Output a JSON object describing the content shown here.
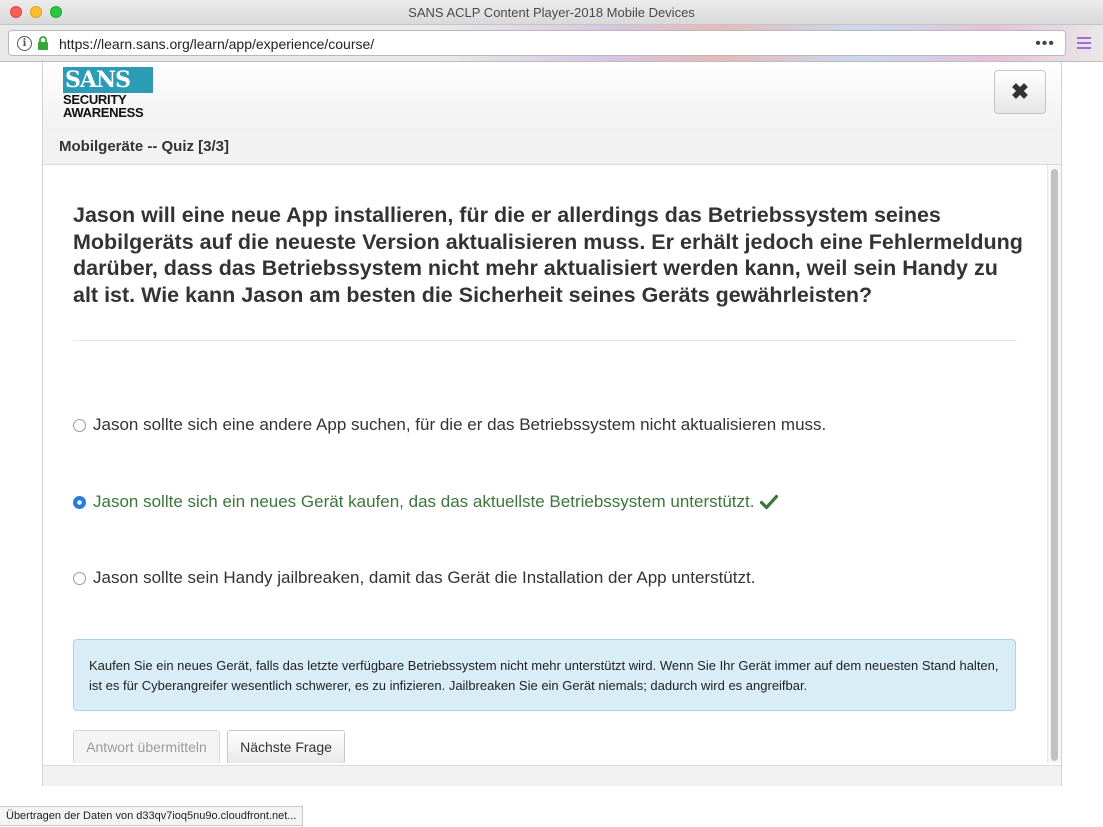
{
  "window": {
    "title": "SANS ACLP Content Player-2018 Mobile Devices"
  },
  "browser": {
    "url": "https://learn.sans.org/learn/app/experience/course/",
    "more_label": "•••",
    "status_text": "Übertragen der Daten von d33qv7ioq5nu9o.cloudfront.net..."
  },
  "logo": {
    "brand": "SANS",
    "line1": "SECURITY",
    "line2": "AWARENESS"
  },
  "header": {
    "close_label": "✖"
  },
  "breadcrumb": {
    "title": "Mobilgeräte -- Quiz [3/3]"
  },
  "quiz": {
    "question": "Jason will eine neue App installieren, für die er allerdings das Betriebssystem seines Mobilgeräts auf die neueste Version aktualisieren muss. Er erhält jedoch eine Fehlermeldung darüber, dass das Betriebssystem nicht mehr aktualisiert werden kann, weil sein Handy zu alt ist. Wie kann Jason am besten die Sicherheit seines Geräts gewährleisten?",
    "options": [
      {
        "label": "Jason sollte sich eine andere App suchen, für die er das Betriebssystem nicht aktualisieren muss.",
        "selected": false,
        "correct": false
      },
      {
        "label": "Jason sollte sich ein neues Gerät kaufen, das das aktuellste Betriebssystem unterstützt.",
        "selected": true,
        "correct": true
      },
      {
        "label": "Jason sollte sein Handy jailbreaken, damit das Gerät die Installation der App unterstützt.",
        "selected": false,
        "correct": false
      }
    ],
    "feedback": "Kaufen Sie ein neues Gerät, falls das letzte verfügbare Betriebssystem nicht mehr unterstützt wird. Wenn Sie Ihr Gerät immer auf dem neuesten Stand halten, ist es für Cyberangreifer wesentlich schwerer, es zu infizieren. Jailbreaken Sie ein Gerät niemals; dadurch wird es angreifbar.",
    "submit_label": "Antwort übermitteln",
    "next_label": "Nächste Frage"
  },
  "colors": {
    "correct": "#3c763d",
    "feedback_bg": "#d9edf7",
    "brand": "#2c9bb6",
    "radio_selected": "#2a7ae2"
  }
}
